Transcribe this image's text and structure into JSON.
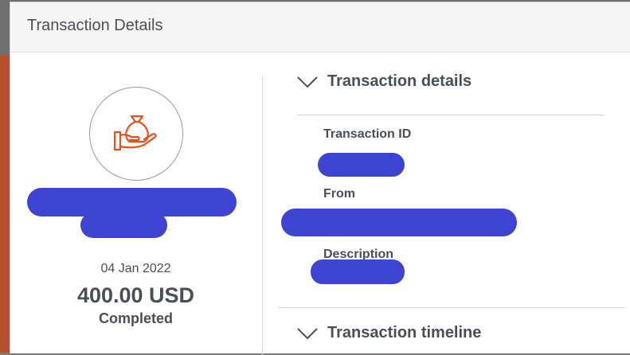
{
  "modal": {
    "title": "Transaction Details"
  },
  "summary": {
    "icon": "hand-money-bag-icon",
    "date": "04 Jan 2022",
    "amount": "400.00 USD",
    "status": "Completed"
  },
  "sections": {
    "details": {
      "title": "Transaction details",
      "fields": [
        {
          "label": "Transaction ID",
          "value": ""
        },
        {
          "label": "From",
          "value": ""
        },
        {
          "label": "Description",
          "value": ""
        }
      ]
    },
    "timeline": {
      "title": "Transaction timeline"
    }
  },
  "colors": {
    "accent": "#e8501c",
    "redaction": "#3d44d1",
    "text": "#4a4f57"
  }
}
